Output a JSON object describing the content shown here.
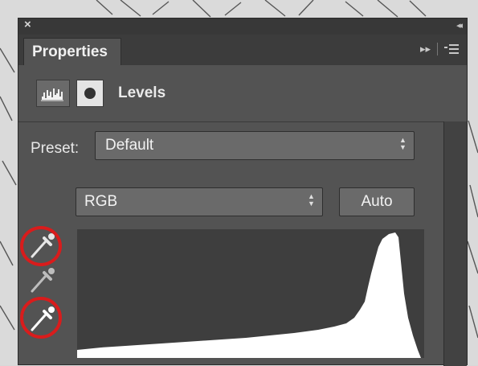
{
  "window": {
    "close_glyph": "×",
    "collapse_glyph": "◂◂"
  },
  "tab": {
    "label": "Properties",
    "forward_glyph": "▸▸",
    "menu_icon": "panel-menu-icon"
  },
  "header": {
    "adjustment_icon": "levels-histogram-icon",
    "mask_icon": "layer-mask-icon",
    "title": "Levels"
  },
  "preset": {
    "label": "Preset:",
    "value": "Default"
  },
  "channel": {
    "value": "RGB"
  },
  "auto_button": {
    "label": "Auto"
  },
  "eyedroppers": [
    {
      "name": "black-point-eyedropper",
      "highlighted": true
    },
    {
      "name": "gray-point-eyedropper",
      "highlighted": false
    },
    {
      "name": "white-point-eyedropper",
      "highlighted": true
    }
  ],
  "colors": {
    "panel_bg": "#535353",
    "titlebar_bg": "#383838",
    "control_bg": "#6a6a6a",
    "histogram_bg": "#3e3e3e",
    "histogram_fill": "#ffffff",
    "annotation_red": "#d91c1c"
  }
}
